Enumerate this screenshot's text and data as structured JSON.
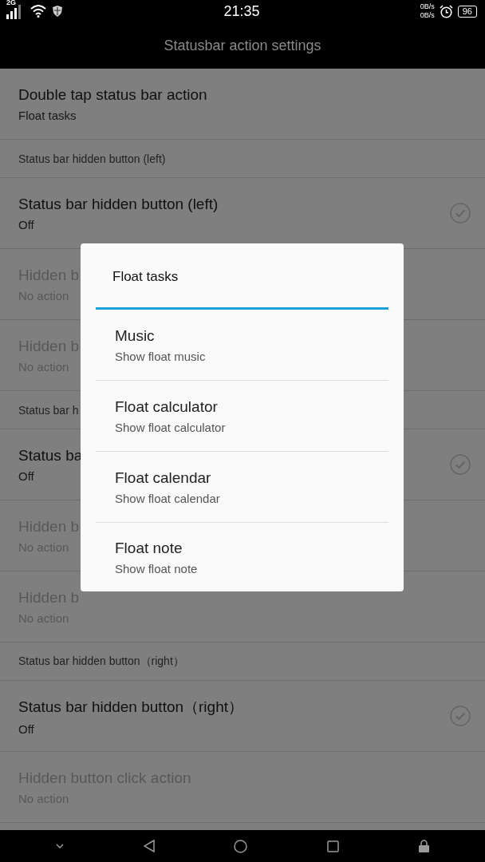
{
  "status_bar": {
    "network": "2G",
    "time": "21:35",
    "upload_speed": "0B/s",
    "download_speed": "0B/s",
    "battery": "96"
  },
  "title": "Statusbar action settings",
  "rows": [
    {
      "kind": "setting",
      "title": "Double tap status bar action",
      "value": "Float tasks",
      "disabled": false
    },
    {
      "kind": "header",
      "title": "Status bar hidden button (left)"
    },
    {
      "kind": "check",
      "title": "Status bar hidden button (left)",
      "value": "Off",
      "checked": false
    },
    {
      "kind": "setting",
      "title": "Hidden b",
      "value": "No action",
      "disabled": true
    },
    {
      "kind": "setting",
      "title": "Hidden b",
      "value": "No action",
      "disabled": true
    },
    {
      "kind": "header",
      "title": "Status bar h"
    },
    {
      "kind": "check",
      "title": "Status ba",
      "value": "Off",
      "checked": false
    },
    {
      "kind": "setting",
      "title": "Hidden b",
      "value": "No action",
      "disabled": true
    },
    {
      "kind": "setting",
      "title": "Hidden b",
      "value": "No action",
      "disabled": true
    },
    {
      "kind": "header",
      "title": "Status bar hidden button（right）"
    },
    {
      "kind": "check",
      "title": "Status bar hidden button（right）",
      "value": "Off",
      "checked": false
    },
    {
      "kind": "setting",
      "title": "Hidden button click action",
      "value": "No action",
      "disabled": true
    }
  ],
  "dialog": {
    "title": "Float tasks",
    "options": [
      {
        "title": "Music",
        "subtitle": "Show float music"
      },
      {
        "title": "Float calculator",
        "subtitle": "Show float calculator"
      },
      {
        "title": "Float calendar",
        "subtitle": "Show float calendar"
      },
      {
        "title": "Float note",
        "subtitle": "Show float note"
      }
    ]
  }
}
